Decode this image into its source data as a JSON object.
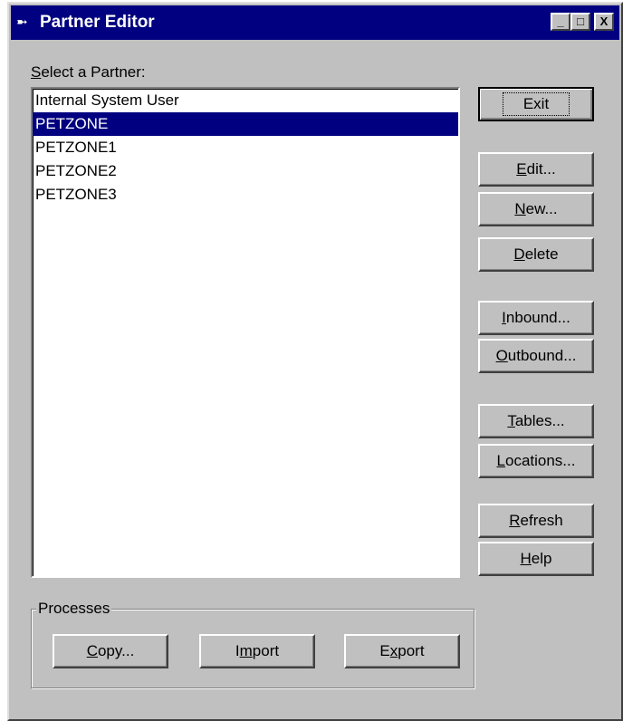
{
  "window": {
    "title": "Partner Editor",
    "icon": "app-icon",
    "controls": {
      "minimize": "_",
      "maximize": "□",
      "close": "X"
    }
  },
  "list": {
    "label_accel": "S",
    "label_rest": "elect a Partner:",
    "items": [
      "Internal System User",
      "PETZONE",
      "PETZONE1",
      "PETZONE2",
      "PETZONE3"
    ],
    "selected_index": 1
  },
  "buttons": {
    "exit": "Exit",
    "edit": {
      "accel": "E",
      "rest": "dit..."
    },
    "new": {
      "accel": "N",
      "rest": "ew..."
    },
    "delete": {
      "accel": "D",
      "rest": "elete"
    },
    "inbound": {
      "accel": "I",
      "rest": "nbound..."
    },
    "outbound": {
      "accel": "O",
      "rest": "utbound..."
    },
    "tables": {
      "accel": "T",
      "rest": "ables..."
    },
    "locations": {
      "accel": "L",
      "rest": "ocations..."
    },
    "refresh": {
      "accel": "R",
      "rest": "efresh"
    },
    "help": {
      "accel": "H",
      "rest": "elp"
    }
  },
  "processes": {
    "label": "Processes",
    "copy": {
      "accel": "C",
      "rest": "opy..."
    },
    "import": {
      "pre": "I",
      "accel": "m",
      "rest": "port"
    },
    "export": {
      "pre": "E",
      "accel": "x",
      "rest": "port"
    }
  }
}
